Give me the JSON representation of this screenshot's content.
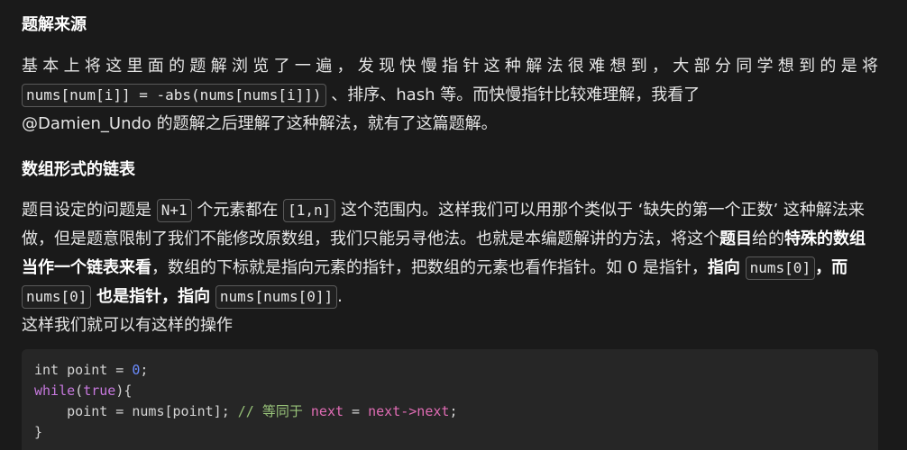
{
  "section1": {
    "title": "题解来源",
    "p1_text_a": "基本上将这里面的题解浏览了一遍，发现快慢指针这种解法很难想到，大部分同学想到的是将",
    "p1_code": "nums[num[i]] = -abs(nums[nums[i]])",
    "p1_text_b": "、排序、hash 等。而快慢指针比较难理解，我看了",
    "p1_text_c": "@Damien_Undo 的题解之后理解了这种解法，就有了这篇题解。"
  },
  "section2": {
    "title": "数组形式的链表",
    "p2_text_a": "题目设定的问题是",
    "p2_code_1": "N+1",
    "p2_text_b": "个元素都在",
    "p2_code_2": "[1,n]",
    "p2_text_c": "这个范围内。这样我们可以用那个类似于 ‘缺失的第一个正数’ 这种解法来做，但是题意限制了我们不能修改原数组，我们只能另寻他法。也就是本编题解讲的方法，将这",
    "p2_text_d": "个",
    "p2_bold_1": "题目",
    "p2_text_e": "给的",
    "p2_bold_2": "特殊的数组当作一个链表来看",
    "p2_text_f": "，数组的下标就是指向元素的指针，把数组的元素也看作指针。如 0 是指针，",
    "p2_bold_3": "指向",
    "p2_code_3": "nums[0]",
    "p2_bold_4": "，而",
    "p2_code_4": "nums[0]",
    "p2_bold_5": "也是指针，指向",
    "p2_code_5": "nums[nums[0]]",
    "p2_text_g": ".",
    "p3_text": "这样我们就可以有这样的操作"
  },
  "code": {
    "l1_type": "int",
    "l1_rest": " point = ",
    "l1_num": "0",
    "l1_end": ";",
    "l2_kw": "while",
    "l2_paren_open": "(",
    "l2_true": "true",
    "l2_rest": "){",
    "l3_indent": "    ",
    "l3_code": "point = nums[point]; ",
    "l3_comment": "// 等同于 ",
    "l3_next1": "next",
    "l3_eq": " = ",
    "l3_next2": "next->next",
    "l3_semi": ";",
    "l4": "}"
  }
}
